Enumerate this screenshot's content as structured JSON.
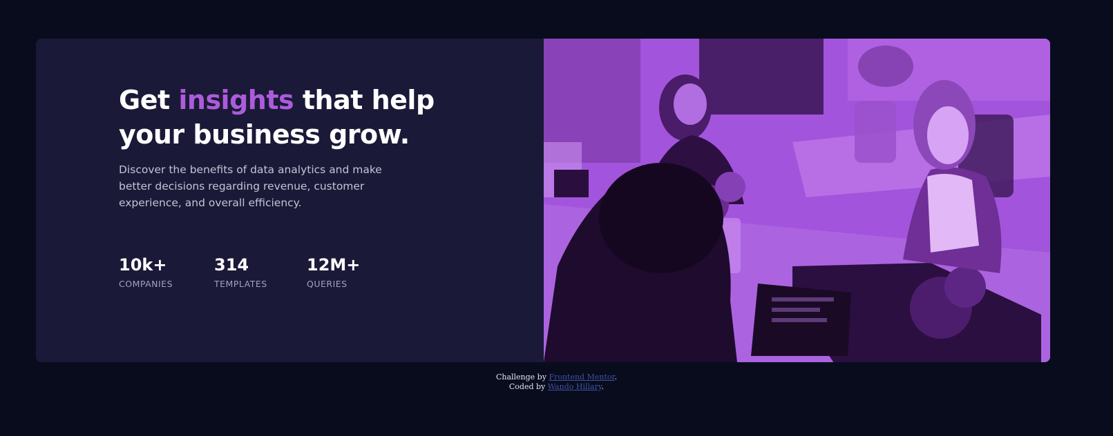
{
  "hero": {
    "headline_part1": "Get ",
    "headline_accent": "insights",
    "headline_part2": " that help your business grow.",
    "description": "Discover the benefits of data analytics and make better decisions regarding revenue, customer experience, and overall efficiency.",
    "accent_color": "#ab5cdb",
    "card_color": "#1b1938",
    "image_overlay_color": "#a354dc"
  },
  "stats": [
    {
      "value": "10k+",
      "label": "COMPANIES"
    },
    {
      "value": "314",
      "label": "TEMPLATES"
    },
    {
      "value": "12M+",
      "label": "QUERIES"
    }
  ],
  "footer": {
    "line1_prefix": "Challenge by ",
    "line1_link": "Frontend Mentor",
    "line1_suffix": ".",
    "line2_prefix": "Coded by ",
    "line2_link": "Wando Hillary",
    "line2_suffix": "."
  }
}
